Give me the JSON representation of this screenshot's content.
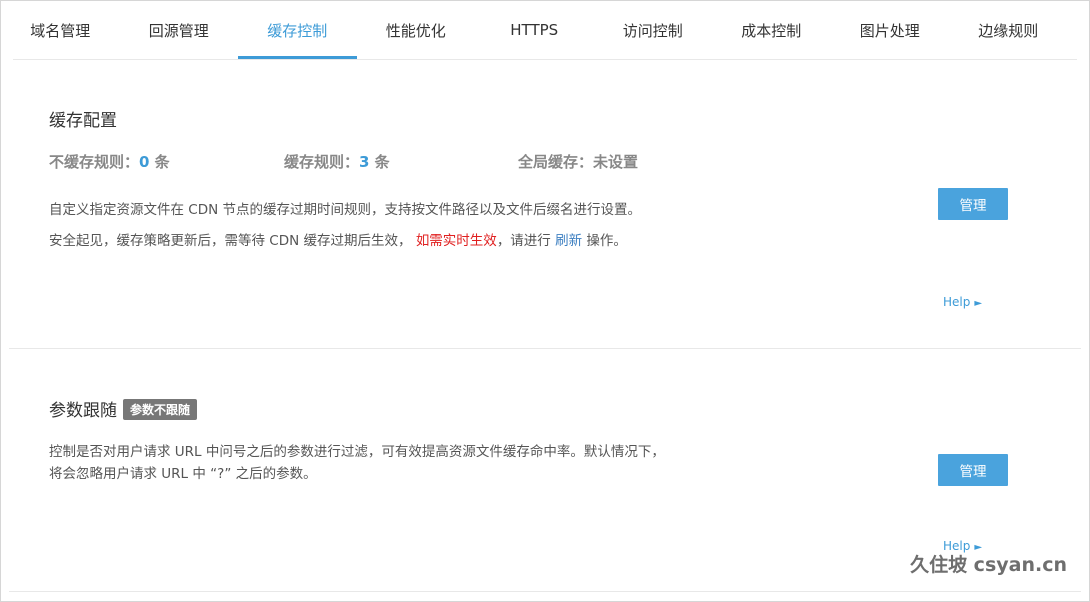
{
  "tabs": [
    {
      "label": "域名管理",
      "active": false
    },
    {
      "label": "回源管理",
      "active": false
    },
    {
      "label": "缓存控制",
      "active": true
    },
    {
      "label": "性能优化",
      "active": false
    },
    {
      "label": "HTTPS",
      "active": false
    },
    {
      "label": "访问控制",
      "active": false
    },
    {
      "label": "成本控制",
      "active": false
    },
    {
      "label": "图片处理",
      "active": false
    },
    {
      "label": "边缘规则",
      "active": false
    }
  ],
  "cache_config": {
    "title": "缓存配置",
    "no_cache_label": "不缓存规则：",
    "no_cache_count": "0",
    "no_cache_unit": " 条",
    "cache_label": "缓存规则：",
    "cache_count": "3",
    "cache_unit": " 条",
    "global_label": "全局缓存：",
    "global_value": "未设置",
    "desc_line1": "自定义指定资源文件在 CDN 节点的缓存过期时间规则，支持按文件路径以及文件后缀名进行设置。",
    "desc_line2_a": "安全起见，缓存策略更新后，需等待 CDN 缓存过期后生效，",
    "desc_line2_red": "如需实时生效",
    "desc_line2_b": "，请进行",
    "desc_line2_link": "刷新",
    "desc_line2_c": "操作。",
    "manage_label": "管理",
    "help_label": "Help",
    "help_arrow": "►"
  },
  "param_follow": {
    "title": "参数跟随",
    "badge": "参数不跟随",
    "desc_line1": "控制是否对用户请求 URL 中问号之后的参数进行过滤，可有效提高资源文件缓存命中率。默认情况下，",
    "desc_line2": "将会忽略用户请求 URL 中 “?” 之后的参数。",
    "manage_label": "管理",
    "help_label": "Help",
    "help_arrow": "►"
  },
  "watermark": "久住坡 csyan.cn",
  "colors": {
    "accent": "#3d9bd7",
    "button": "#4aa3dd",
    "warning_text": "#e02020",
    "badge_bg": "#777777"
  }
}
